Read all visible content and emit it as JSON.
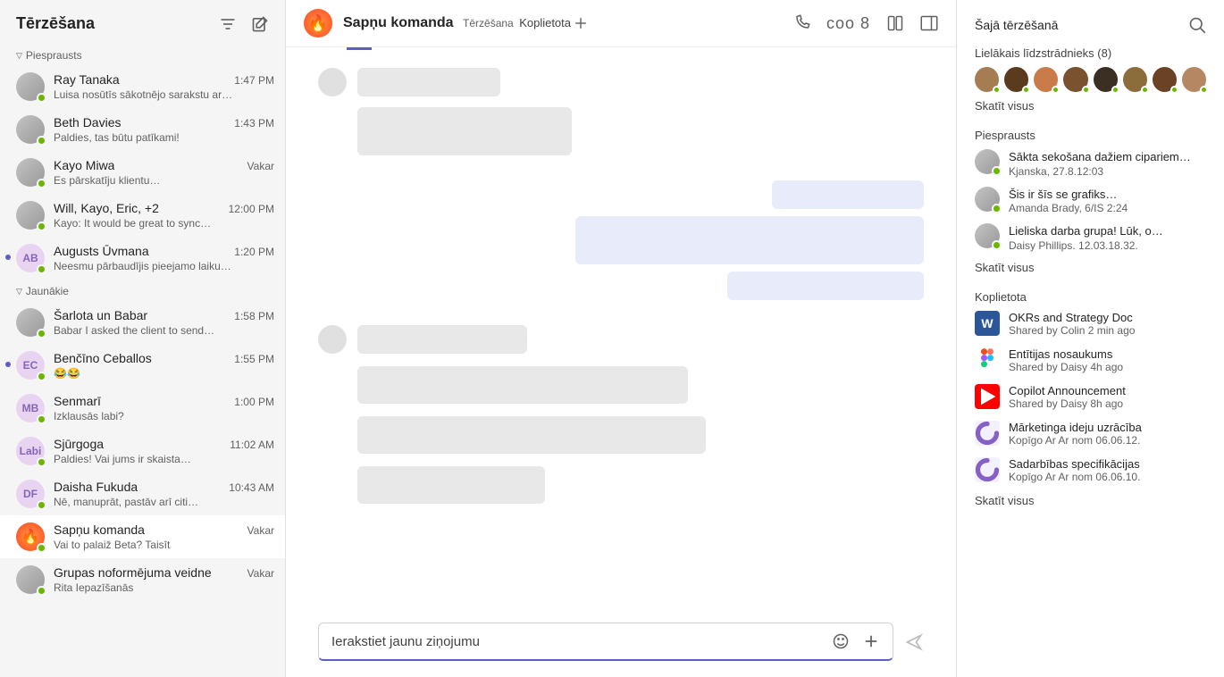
{
  "sidebar": {
    "title": "Tērzēšana",
    "pinned_label": "Piesprausts",
    "recent_label": "Jaunākie",
    "pinned": [
      {
        "name": "Ray Tanaka",
        "time": "1:47 PM",
        "preview": "Luisa nosūtīs sākotnējo sarakstu ar…",
        "initials": "",
        "dot": false
      },
      {
        "name": "Beth Davies",
        "time": "1:43 PM",
        "preview": "Paldies, tas būtu patīkami!",
        "initials": "",
        "dot": false
      },
      {
        "name": "Kayo Miwa",
        "time": "Vakar",
        "preview": "Es pārskatīju klientu…",
        "initials": "",
        "dot": false
      },
      {
        "name": "Will, Kayo, Eric, +2",
        "time": "12:00 PM",
        "preview": "Kayo: It would be great to sync…",
        "initials": "",
        "dot": false
      },
      {
        "name": "Augusts Ūvmana",
        "time": "1:20 PM",
        "preview": "Neesmu pārbaudījis pieejamo laiku…",
        "initials": "AB",
        "dot": true
      }
    ],
    "recent": [
      {
        "name": "Šarlota un       Babar",
        "time": "1:58 PM",
        "preview": "Babar I asked the client to send…",
        "initials": "",
        "dot": false
      },
      {
        "name": "Benčīno Ceballos",
        "time": "1:55 PM",
        "preview": "😂😂",
        "initials": "EC",
        "dot": true
      },
      {
        "name": "Senmarī",
        "time": "1:00 PM",
        "preview": "Izklausās labi?",
        "initials": "MB",
        "dot": false
      },
      {
        "name": "Sjūrgoga",
        "time": "11:02 AM",
        "preview": "Paldies! Vai jums ir skaista…",
        "initials": "Labi",
        "dot": false
      },
      {
        "name": "Daisha Fukuda",
        "time": "10:43 AM",
        "preview": "Nē, manuprāt, pastāv arī citi…",
        "initials": "DF",
        "dot": false
      },
      {
        "name": "Sapņu komanda",
        "time": "Vakar",
        "preview": "Vai to palaiž Beta? Taisīt",
        "initials": "🔥",
        "dot": false,
        "active": true
      },
      {
        "name": "Grupas noformējuma veidne",
        "time": "Vakar",
        "preview": "Rita Iepazīšanās",
        "initials": "",
        "dot": false
      }
    ]
  },
  "header": {
    "title": "Sapņu komanda",
    "tab": "Tērzēšana",
    "shared": "Koplietota",
    "participants": "coo 8"
  },
  "compose": {
    "placeholder": "Ierakstiet jaunu ziņojumu"
  },
  "details": {
    "title": "Šajā tērzēšanā",
    "top_contributor": "Lielākais līdzstrādnieks (8)",
    "see_all": "Skatīt visus",
    "pinned_label": "Piesprausts",
    "pinned": [
      {
        "text": "Sākta sekošana dažiem cipariem…",
        "meta": "Kjanska, 27.8.12:03"
      },
      {
        "text": "Šis ir šīs se grafiks…",
        "meta": "Amanda Brady, 6/IS 2:24"
      },
      {
        "text": "Lieliska darba grupa! Lūk, o…",
        "meta": "Daisy Phillips. 12.03.18.32."
      }
    ],
    "shared_label": "Koplietota",
    "files": [
      {
        "icon": "word",
        "name": "OKRs and Strategy Doc",
        "meta": "Shared by Colin 2 min ago"
      },
      {
        "icon": "figma",
        "name": "Entītijas nosaukums",
        "meta": "Shared by Daisy 4h ago"
      },
      {
        "icon": "youtube",
        "name": "Copilot Announcement",
        "meta": "Shared by Daisy 8h ago"
      },
      {
        "icon": "loop",
        "name": "Mārketinga ideju uzrācība",
        "meta": "Kopīgo Ar Ar nom 06.06.12."
      },
      {
        "icon": "loop",
        "name": "Sadarbības specifikācijas",
        "meta": "Kopīgo Ar Ar nom 06.06.10."
      }
    ]
  },
  "avatar_colors": [
    "#a67c52",
    "#5b3b1e",
    "#c97b4a",
    "#7a5230",
    "#3b2f23",
    "#8a6d3b",
    "#6b4226",
    "#b58863"
  ]
}
